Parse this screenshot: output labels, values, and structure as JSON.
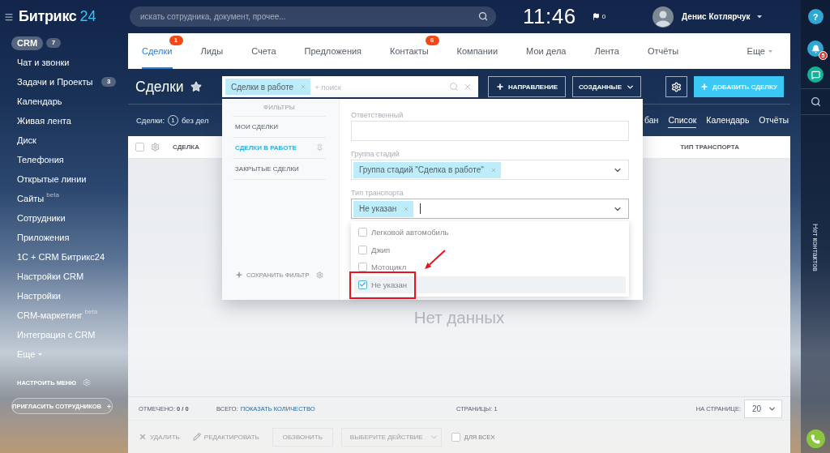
{
  "header": {
    "logo": {
      "name": "Битрикс",
      "accent": "24"
    },
    "search": {
      "placeholder": "искать сотрудника, документ, прочее..."
    },
    "clock": "11:46",
    "flag_count": "0",
    "user": {
      "name": "Денис Котлярчук"
    }
  },
  "sidebar": {
    "items": [
      {
        "label": "CRM",
        "badge": "7",
        "selected": true
      },
      {
        "label": "Чат и звонки",
        "selected": false
      },
      {
        "label": "Задачи и Проекты",
        "badge": "3",
        "selected": false
      },
      {
        "label": "Календарь",
        "selected": false
      },
      {
        "label": "Живая лента",
        "selected": false
      },
      {
        "label": "Диск",
        "selected": false
      },
      {
        "label": "Телефония",
        "selected": false
      },
      {
        "label": "Открытые линии",
        "selected": false
      },
      {
        "label": "Сайты $^{beta}$",
        "selected": false
      },
      {
        "label": "Сотрудники",
        "selected": false
      },
      {
        "label": "Приложения",
        "selected": false
      },
      {
        "label": "1С + CRM Битрикс24",
        "selected": false
      },
      {
        "label": "Настройки CRM",
        "selected": false
      },
      {
        "label": "Настройки",
        "selected": false
      },
      {
        "label": "CRM-маркетинг $^{beta}$",
        "selected": false
      },
      {
        "label": "Интеграция с CRM",
        "selected": false
      }
    ],
    "more": "Еще",
    "configure": "НАСТРОИТЬ МЕНЮ",
    "invite": "ПРИГЛАСИТЬ СОТРУДНИКОВ"
  },
  "tabs": [
    {
      "label": "Сделки",
      "badge": "1",
      "selected": true
    },
    {
      "label": "Лиды",
      "selected": false
    },
    {
      "label": "Счета",
      "selected": false
    },
    {
      "label": "Предложения",
      "selected": false
    },
    {
      "label": "Контакты",
      "badge": "6",
      "selected": false
    },
    {
      "label": "Компании",
      "selected": false
    },
    {
      "label": "Мои дела",
      "selected": false
    },
    {
      "label": "Лента",
      "selected": false
    },
    {
      "label": "Отчёты",
      "selected": false
    }
  ],
  "tabs_more": "Еще",
  "toolbar": {
    "title": "Сделки",
    "filter": {
      "tag": "Сделки в работе",
      "placeholder": "+ поиск"
    },
    "buttons": [
      {
        "kind": "add",
        "label": "НАПРАВЛЕНИЕ"
      },
      {
        "kind": "dropdown",
        "label": "СОЗДАННЫЕ"
      },
      {
        "kind": "settings"
      },
      {
        "kind": "primary",
        "label": "ДОБАВИТЬ СДЕЛКУ"
      }
    ]
  },
  "summary": {
    "label": "Сделки:",
    "count": "1",
    "note": "без дел"
  },
  "views": [
    {
      "label": "бан",
      "selected": false
    },
    {
      "label": "Список",
      "selected": true
    },
    {
      "label": "Календарь",
      "selected": false
    },
    {
      "label": "Отчёты",
      "selected": false
    }
  ],
  "grid": {
    "select_all": {
      "checked": false
    },
    "columns": [
      "СДЕЛКА",
      "ТИП ТРАНСПОРТА"
    ],
    "empty": "Нет данных",
    "footer": {
      "checked": "ОТМЕЧЕНО: **0 / 0**",
      "total_label": "ВСЕГО:",
      "total_link": "ПОКАЗАТЬ КОЛИЧЕСТВО",
      "pages": "СТРАНИЦЫ: 1",
      "per_page_label": "НА СТРАНИЦЕ:",
      "per_page_value": "20"
    },
    "actions": [
      {
        "kind": "delete",
        "label": "УДАЛИТЬ",
        "disabled": true
      },
      {
        "kind": "edit",
        "label": "РЕДАКТИРОВАТЬ",
        "disabled": true
      },
      {
        "kind": "button",
        "label": "ОБЗВОНИТЬ",
        "disabled": true
      },
      {
        "kind": "select",
        "label": "ВЫБЕРИТЕ ДЕЙСТВИЕ",
        "disabled": true
      },
      {
        "kind": "checkbox",
        "label": "ДЛЯ ВСЕХ",
        "checked": false,
        "disabled": true
      }
    ]
  },
  "filter_popup": {
    "heading": "ФИЛЬТРЫ",
    "presets": [
      {
        "label": "МОИ СДЕЛКИ",
        "selected": false,
        "pinned": false
      },
      {
        "label": "СДЕЛКИ В РАБОТЕ",
        "selected": true,
        "pinned": true
      },
      {
        "label": "ЗАКРЫТЫЕ СДЕЛКИ",
        "selected": false,
        "pinned": false
      }
    ],
    "save": "СОХРАНИТЬ ФИЛЬТР",
    "fields": [
      {
        "label": "Ответственный",
        "kind": "text",
        "focused": false
      },
      {
        "label": "Группа стадий",
        "kind": "select",
        "tags": [
          "Группа стадий \"Сделка в работе\""
        ],
        "focused": false
      },
      {
        "label": "Тип транспорта",
        "kind": "select",
        "tags": [
          "Не указан"
        ],
        "focused": true,
        "options": [
          {
            "label": "Легковой автомобиль",
            "checked": false,
            "hovered": false,
            "annotated": false
          },
          {
            "label": "Джип",
            "checked": false,
            "hovered": false,
            "annotated": false
          },
          {
            "label": "Мотоцикл",
            "checked": false,
            "hovered": false,
            "annotated": false
          },
          {
            "label": "Не указан",
            "checked": true,
            "hovered": true,
            "annotated": true
          }
        ]
      }
    ]
  },
  "right_panel": {
    "help": "?",
    "notifications": "5",
    "contacts": "Нет контактов"
  }
}
